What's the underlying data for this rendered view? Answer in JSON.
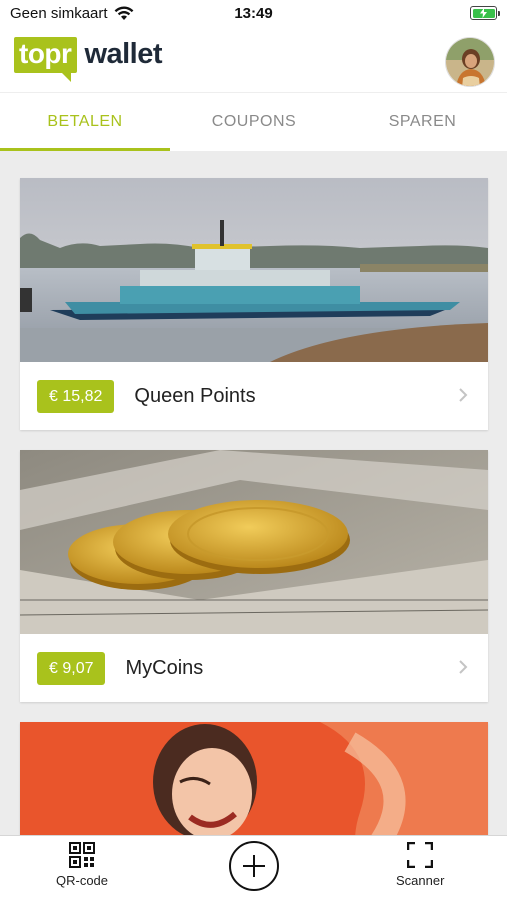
{
  "status": {
    "carrier": "Geen simkaart",
    "time": "13:49"
  },
  "header": {
    "logo_box": "topr",
    "logo_word": "wallet"
  },
  "tabs": [
    {
      "label": "BETALEN",
      "active": true
    },
    {
      "label": "COUPONS",
      "active": false
    },
    {
      "label": "SPAREN",
      "active": false
    }
  ],
  "cards": [
    {
      "amount": "€ 15,82",
      "title": "Queen Points",
      "image": "ferry-photo"
    },
    {
      "amount": "€ 9,07",
      "title": "MyCoins",
      "image": "coins-photo"
    },
    {
      "image": "vintage-woman-photo"
    }
  ],
  "bottom_bar": {
    "qr_label": "QR-code",
    "scanner_label": "Scanner"
  },
  "colors": {
    "brand": "#a9c21c",
    "logo_text": "#1f2a38",
    "background": "#ececec"
  }
}
